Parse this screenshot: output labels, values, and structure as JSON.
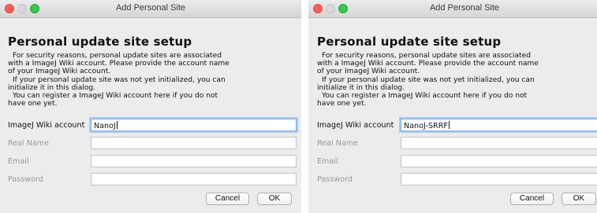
{
  "dialogs": [
    {
      "window_title": "Add Personal Site",
      "heading": "Personal update site setup",
      "description_lines": [
        "For security reasons, personal update sites are associated",
        "with a ImageJ Wiki account. Please provide the account name",
        "of your ImageJ Wiki account.",
        "If your personal update site was not yet initialized, you can",
        "initialize it in this dialog.",
        "You can register a ImageJ Wiki account here if you do not",
        "have one yet."
      ],
      "fields": {
        "account_label": "ImageJ Wiki account",
        "account_value": "NanoJ",
        "realname_label": "Real Name",
        "realname_value": "",
        "email_label": "Email",
        "email_value": "",
        "password_label": "Password",
        "password_value": ""
      },
      "buttons": {
        "cancel": "Cancel",
        "ok": "OK"
      }
    },
    {
      "window_title": "Add Personal Site",
      "heading": "Personal update site setup",
      "description_lines": [
        "For security reasons, personal update sites are associated",
        "with a ImageJ Wiki account. Please provide the account name",
        "of your ImageJ Wiki account.",
        "If your personal update site was not yet initialized, you can",
        "initialize it in this dialog.",
        "You can register a ImageJ Wiki account here if you do not",
        "have one yet."
      ],
      "fields": {
        "account_label": "ImageJ Wiki account",
        "account_value": "NanoJ-SRRF",
        "realname_label": "Real Name",
        "realname_value": "",
        "email_label": "Email",
        "email_value": "",
        "password_label": "Password",
        "password_value": ""
      },
      "buttons": {
        "cancel": "Cancel",
        "ok": "OK"
      }
    }
  ],
  "colors": {
    "dialog_bg": "#ececec",
    "close_button": "#fc5f57",
    "zoom_button": "#35c84a",
    "focus_ring": "#7fb2e4"
  },
  "icons": [
    "close-icon",
    "minimize-icon",
    "zoom-icon"
  ]
}
